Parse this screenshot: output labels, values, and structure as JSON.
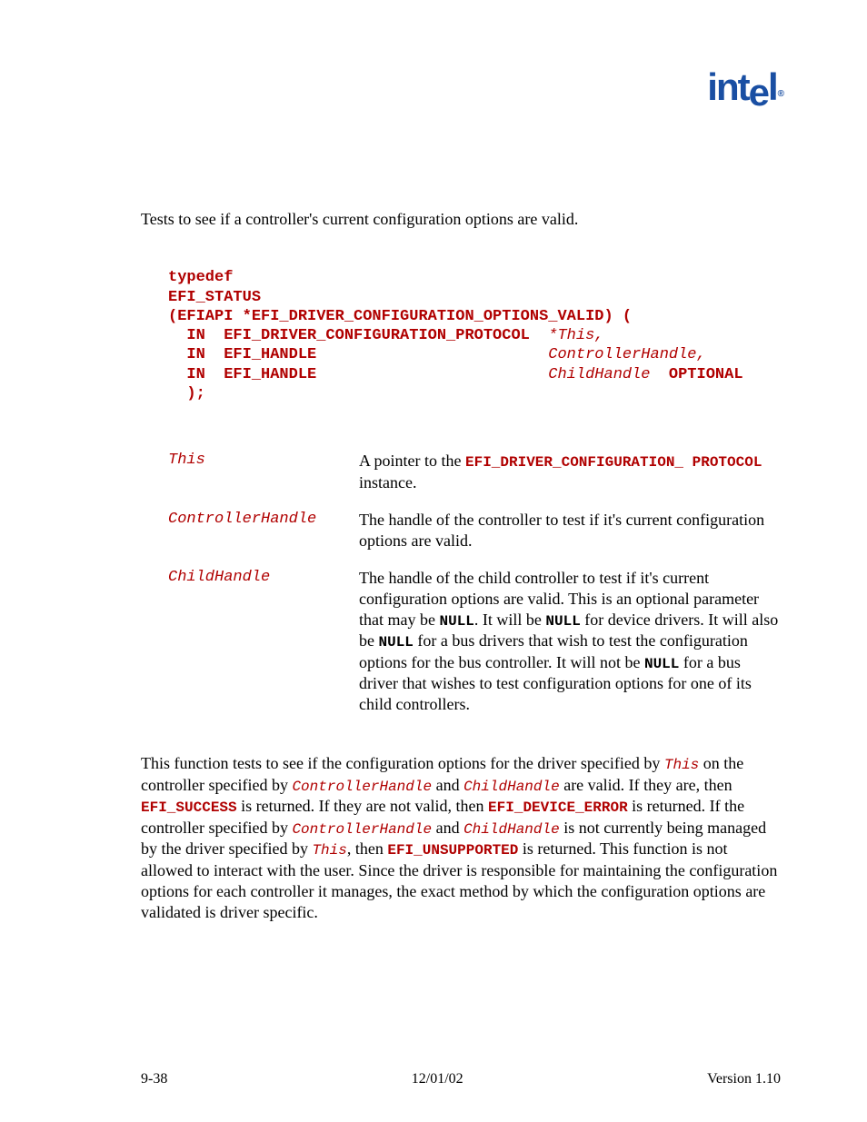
{
  "logo": "intel",
  "summary": "Tests to see if a controller's current configuration options are valid.",
  "prototype": {
    "l1": "typedef",
    "l2": "EFI_STATUS",
    "l3a": "(EFIAPI *EFI_DRIVER_CONFIGURATION_OPTIONS_VALID) (",
    "l4a": "  IN  EFI_DRIVER_CONFIGURATION_PROTOCOL  ",
    "l4b": "*",
    "l4c": "This,",
    "l5a": "  IN  EFI_HANDLE                         ",
    "l5b": "ControllerHandle,",
    "l6a": "  IN  EFI_HANDLE                         ",
    "l6b": "ChildHandle",
    "l6c": "  OPTIONAL",
    "l7": "  );"
  },
  "params": {
    "this": {
      "name": "This",
      "d1": "A pointer to the ",
      "d2": "EFI_DRIVER_CONFIGURATION_ PROTOCOL",
      "d3": " instance."
    },
    "ch": {
      "name": "ControllerHandle",
      "d1": "The handle of the controller to test if it's current configuration options are valid."
    },
    "child": {
      "name": "ChildHandle",
      "d1": "The handle of the child controller to test if it's current configuration options are valid.  This is an optional parameter that may be ",
      "d2": "NULL",
      "d3": ".  It will be ",
      "d4": "NULL",
      "d5": " for device drivers.  It will also be ",
      "d6": "NULL",
      "d7": " for a bus drivers that wish to test the configuration options for the bus controller.  It will not be ",
      "d8": "NULL",
      "d9": " for a bus driver that wishes to test configuration options for one of its child controllers."
    }
  },
  "desc": {
    "p1": "This function tests to see if the configuration options for the driver specified by ",
    "p2": "This",
    "p3": " on the controller specified by ",
    "p4": "ControllerHandle",
    "p5": " and ",
    "p6": "ChildHandle",
    "p7": " are valid.  If they are, then ",
    "p8": "EFI_SUCCESS",
    "p9": " is returned.  If they are not valid, then ",
    "p10": "EFI_DEVICE_ERROR",
    "p11": " is returned.  If the controller specified by ",
    "p12": "ControllerHandle",
    "p13": " and ",
    "p14": "ChildHandle",
    "p15": " is not currently being managed by the driver specified by ",
    "p16": "This",
    "p17": ", then ",
    "p18": "EFI_UNSUPPORTED",
    "p19": " is returned.  This function is not allowed to interact with the user.  Since the driver is responsible for maintaining the configuration options for each controller it manages, the exact method by which the configuration options are validated is driver specific."
  },
  "footer": {
    "left": "9-38",
    "center": "12/01/02",
    "right": "Version 1.10"
  }
}
